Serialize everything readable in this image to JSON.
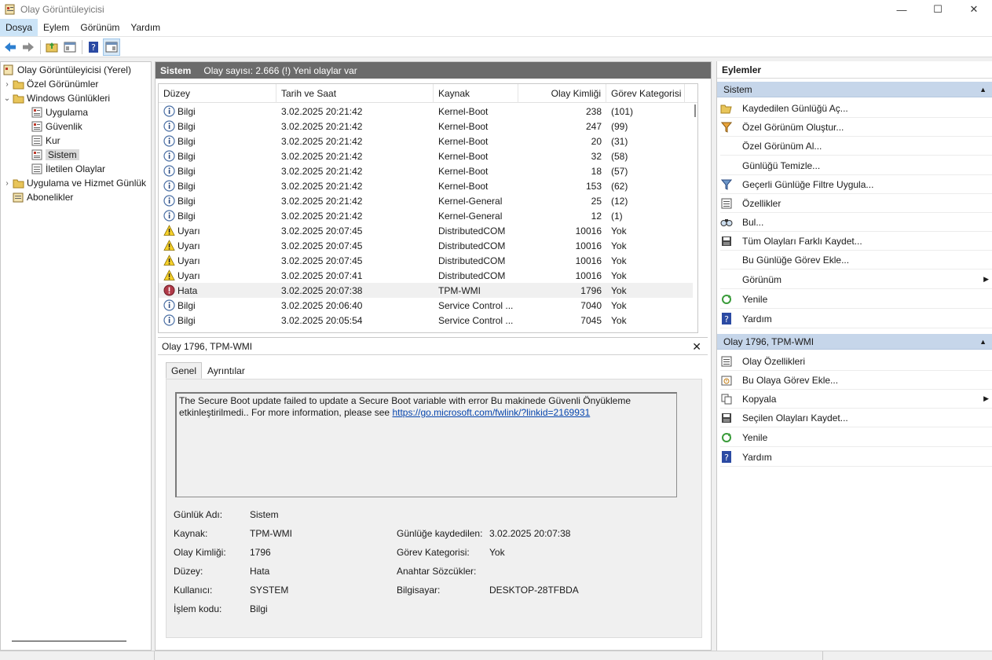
{
  "window": {
    "title": "Olay Görüntüleyicisi",
    "minimize": "—",
    "maximize": "☐",
    "close": "✕"
  },
  "menu": [
    "Dosya",
    "Eylem",
    "Görünüm",
    "Yardım"
  ],
  "tree": {
    "root": "Olay Görüntüleyicisi (Yerel)",
    "custom_views": "Özel Görünümler",
    "windows_logs": "Windows Günlükleri",
    "application": "Uygulama",
    "security": "Güvenlik",
    "setup": "Kur",
    "system": "Sistem",
    "forwarded": "İletilen Olaylar",
    "app_services": "Uygulama ve Hizmet Günlük",
    "subscriptions": "Abonelikler"
  },
  "center": {
    "title": "Sistem",
    "count_text": "Olay sayısı: 2.666 (!) Yeni olaylar var",
    "columns": {
      "level": "Düzey",
      "date": "Tarih ve Saat",
      "source": "Kaynak",
      "id": "Olay Kimliği",
      "category": "Görev Kategorisi"
    },
    "rows": [
      {
        "type": "info",
        "level": "Bilgi",
        "date": "3.02.2025 20:21:42",
        "source": "Kernel-Boot",
        "id": "238",
        "category": "(101)"
      },
      {
        "type": "info",
        "level": "Bilgi",
        "date": "3.02.2025 20:21:42",
        "source": "Kernel-Boot",
        "id": "247",
        "category": "(99)"
      },
      {
        "type": "info",
        "level": "Bilgi",
        "date": "3.02.2025 20:21:42",
        "source": "Kernel-Boot",
        "id": "20",
        "category": "(31)"
      },
      {
        "type": "info",
        "level": "Bilgi",
        "date": "3.02.2025 20:21:42",
        "source": "Kernel-Boot",
        "id": "32",
        "category": "(58)"
      },
      {
        "type": "info",
        "level": "Bilgi",
        "date": "3.02.2025 20:21:42",
        "source": "Kernel-Boot",
        "id": "18",
        "category": "(57)"
      },
      {
        "type": "info",
        "level": "Bilgi",
        "date": "3.02.2025 20:21:42",
        "source": "Kernel-Boot",
        "id": "153",
        "category": "(62)"
      },
      {
        "type": "info",
        "level": "Bilgi",
        "date": "3.02.2025 20:21:42",
        "source": "Kernel-General",
        "id": "25",
        "category": "(12)"
      },
      {
        "type": "info",
        "level": "Bilgi",
        "date": "3.02.2025 20:21:42",
        "source": "Kernel-General",
        "id": "12",
        "category": "(1)"
      },
      {
        "type": "warn",
        "level": "Uyarı",
        "date": "3.02.2025 20:07:45",
        "source": "DistributedCOM",
        "id": "10016",
        "category": "Yok"
      },
      {
        "type": "warn",
        "level": "Uyarı",
        "date": "3.02.2025 20:07:45",
        "source": "DistributedCOM",
        "id": "10016",
        "category": "Yok"
      },
      {
        "type": "warn",
        "level": "Uyarı",
        "date": "3.02.2025 20:07:45",
        "source": "DistributedCOM",
        "id": "10016",
        "category": "Yok"
      },
      {
        "type": "warn",
        "level": "Uyarı",
        "date": "3.02.2025 20:07:41",
        "source": "DistributedCOM",
        "id": "10016",
        "category": "Yok"
      },
      {
        "type": "error",
        "level": "Hata",
        "date": "3.02.2025 20:07:38",
        "source": "TPM-WMI",
        "id": "1796",
        "category": "Yok"
      },
      {
        "type": "info",
        "level": "Bilgi",
        "date": "3.02.2025 20:06:40",
        "source": "Service Control ...",
        "id": "7040",
        "category": "Yok"
      },
      {
        "type": "info",
        "level": "Bilgi",
        "date": "3.02.2025 20:05:54",
        "source": "Service Control ...",
        "id": "7045",
        "category": "Yok"
      }
    ]
  },
  "detail": {
    "title": "Olay 1796, TPM-WMI",
    "close": "✕",
    "tab_general": "Genel",
    "tab_details": "Ayrıntılar",
    "description": "The Secure Boot update failed to update a Secure Boot variable with error Bu makinede Güvenli Önyükleme etkinleştirilmedi.. For more information, please see ",
    "link": "https://go.microsoft.com/fwlink/?linkid=2169931",
    "labels": {
      "log_name": "Günlük Adı:",
      "source": "Kaynak:",
      "event_id": "Olay Kimliği:",
      "level": "Düzey:",
      "user": "Kullanıcı:",
      "opcode": "İşlem kodu:",
      "logged": "Günlüğe kaydedilen:",
      "task_category": "Görev Kategorisi:",
      "keywords": "Anahtar Sözcükler:",
      "computer": "Bilgisayar:"
    },
    "values": {
      "log_name": "Sistem",
      "source": "TPM-WMI",
      "event_id": "1796",
      "level": "Hata",
      "user": "SYSTEM",
      "opcode": "Bilgi",
      "logged": "3.02.2025 20:07:38",
      "task_category": "Yok",
      "keywords": "",
      "computer": "DESKTOP-28TFBDA"
    }
  },
  "actions": {
    "title": "Eylemler",
    "section1": "Sistem",
    "section1_items": [
      "Kaydedilen Günlüğü Aç...",
      "Özel Görünüm Oluştur...",
      "Özel Görünüm Al...",
      "Günlüğü Temizle...",
      "Geçerli Günlüğe Filtre Uygula...",
      "Özellikler",
      "Bul...",
      "Tüm Olayları Farklı Kaydet...",
      "Bu Günlüğe Görev Ekle...",
      "Görünüm",
      "Yenile",
      "Yardım"
    ],
    "section2": "Olay 1796, TPM-WMI",
    "section2_items": [
      "Olay Özellikleri",
      "Bu Olaya Görev Ekle...",
      "Kopyala",
      "Seçilen Olayları Kaydet...",
      "Yenile",
      "Yardım"
    ]
  }
}
